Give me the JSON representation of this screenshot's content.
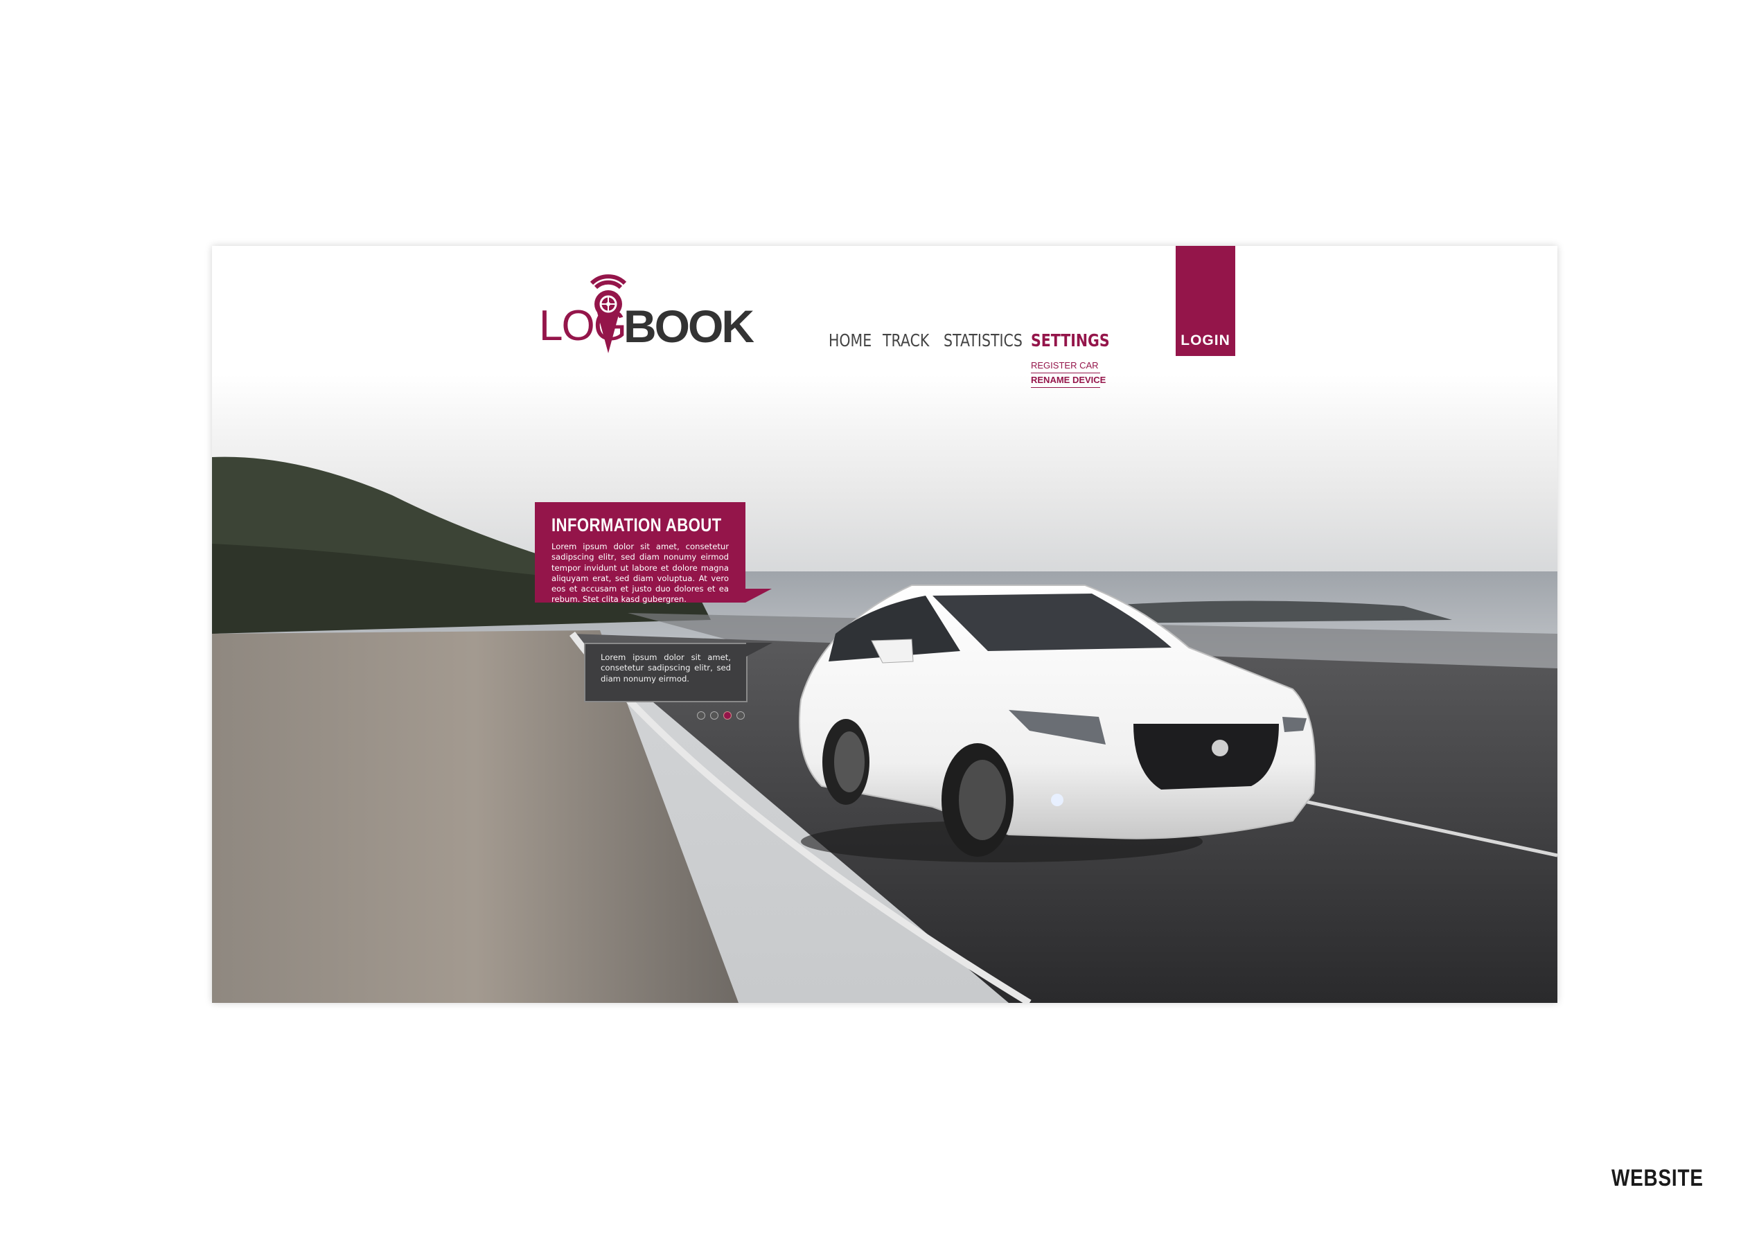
{
  "logo": {
    "part1": "LOG",
    "part2": "BOOK"
  },
  "nav": {
    "items": [
      {
        "label": "HOME"
      },
      {
        "label": "TRACK"
      },
      {
        "label": "STATISTICS"
      },
      {
        "label": "SETTINGS",
        "active": true
      }
    ],
    "submenu": [
      {
        "label": "REGISTER CAR"
      },
      {
        "label": "RENAME DEVICE",
        "active": true
      }
    ],
    "login_label": "LOGIN"
  },
  "info": {
    "title": "INFORMATION ABOUT",
    "text": "Lorem ipsum dolor sit amet, consetetur sadipscing elitr, sed diam nonumy eirmod tempor invidunt ut labore et dolore magna aliquyam erat, sed diam voluptua. At vero eos et accusam et justo duo dolores et ea rebum. Stet clita kasd gubergren.",
    "secondary_text": "Lorem ipsum dolor sit amet, consetetur sadipscing elitr, sed diam nonumy eirmod."
  },
  "slider": {
    "count": 4,
    "active_index": 3
  },
  "caption": "WEBSITE",
  "colors": {
    "accent": "#94154a",
    "dark": "#3e3e40",
    "text": "#444444"
  }
}
